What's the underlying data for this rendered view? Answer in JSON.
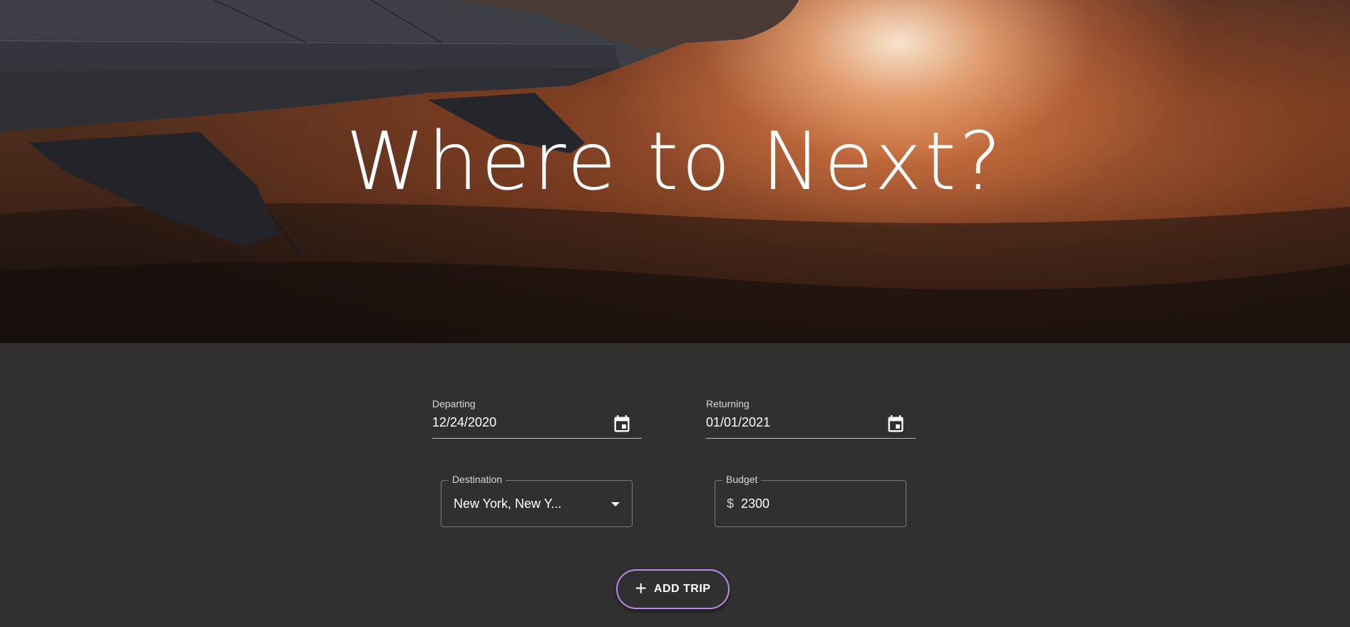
{
  "hero": {
    "title": "Where to Next?"
  },
  "form": {
    "departing": {
      "label": "Departing",
      "value": "12/24/2020",
      "icon": "calendar-icon"
    },
    "returning": {
      "label": "Returning",
      "value": "01/01/2021",
      "icon": "calendar-icon"
    },
    "destination": {
      "label": "Destination",
      "selected": "New York, New Y...",
      "icon": "chevron-down-icon"
    },
    "budget": {
      "label": "Budget",
      "prefix": "$",
      "value": "2300"
    },
    "add_trip": {
      "label": "ADD TRIP",
      "icon": "plus-icon"
    }
  },
  "colors": {
    "background": "#303030",
    "accent_outline": "#b98ae8",
    "text": "#ffffff"
  }
}
